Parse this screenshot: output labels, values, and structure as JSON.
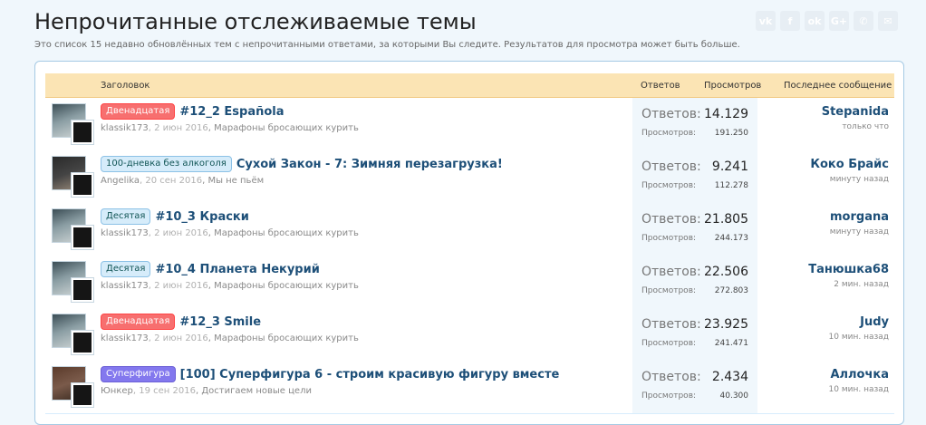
{
  "page": {
    "title": "Непрочитанные отслеживаемые темы",
    "description": "Это список 15 недавно обновлённых тем с непрочитанными ответами, за которыми Вы следите. Результатов для просмотра может быть больше."
  },
  "share_icons": [
    "vk-icon",
    "facebook-icon",
    "odnoklassniki-icon",
    "googleplus-icon",
    "viber-icon",
    "whatsapp-icon"
  ],
  "share_labels": [
    "vk",
    "f",
    "ok",
    "G+",
    "✆",
    "✉"
  ],
  "table": {
    "headers": {
      "title": "Заголовок",
      "replies": "Ответов",
      "views": "Просмотров",
      "last": "Последнее сообщение"
    },
    "replies_label": "Ответов:",
    "views_label": "Просмотров:",
    "rows": [
      {
        "prefix": "Двенадцатая",
        "prefix_style": "red",
        "title": "#12_2 Española",
        "author": "klassik173",
        "date": "2 июн 2016",
        "forum": "Марафоны бросающих курить",
        "replies": "14.129",
        "views": "191.250",
        "last_user": "Stepanida",
        "last_time": "только что"
      },
      {
        "prefix": "100-дневка без алкоголя",
        "prefix_style": "blue",
        "title": "Сухой Закон - 7: Зимняя перезагрузка!",
        "author": "Angelika",
        "date": "20 сен 2016",
        "forum": "Мы не пьём",
        "replies": "9.241",
        "views": "112.278",
        "last_user": "Коко Брайс",
        "last_time": "минуту назад"
      },
      {
        "prefix": "Десятая",
        "prefix_style": "blue",
        "title": "#10_3 Краски",
        "author": "klassik173",
        "date": "2 июн 2016",
        "forum": "Марафоны бросающих курить",
        "replies": "21.805",
        "views": "244.173",
        "last_user": "morgana",
        "last_time": "минуту назад"
      },
      {
        "prefix": "Десятая",
        "prefix_style": "blue",
        "title": "#10_4 Планета Некурий",
        "author": "klassik173",
        "date": "2 июн 2016",
        "forum": "Марафоны бросающих курить",
        "replies": "22.506",
        "views": "272.803",
        "last_user": "Танюшка68",
        "last_time": "2 мин. назад"
      },
      {
        "prefix": "Двенадцатая",
        "prefix_style": "red",
        "title": "#12_3 Smile",
        "author": "klassik173",
        "date": "2 июн 2016",
        "forum": "Марафоны бросающих курить",
        "replies": "23.925",
        "views": "241.471",
        "last_user": "Judy",
        "last_time": "10 мин. назад"
      },
      {
        "prefix": "Суперфигура",
        "prefix_style": "purple",
        "title": "[100] Суперфигура 6 - строим красивую фигуру вместе",
        "author": "Юнкер",
        "date": "19 сен 2016",
        "forum": "Достигаем новые цели",
        "replies": "2.434",
        "views": "40.300",
        "last_user": "Аллочка",
        "last_time": "10 мин. назад"
      }
    ]
  }
}
